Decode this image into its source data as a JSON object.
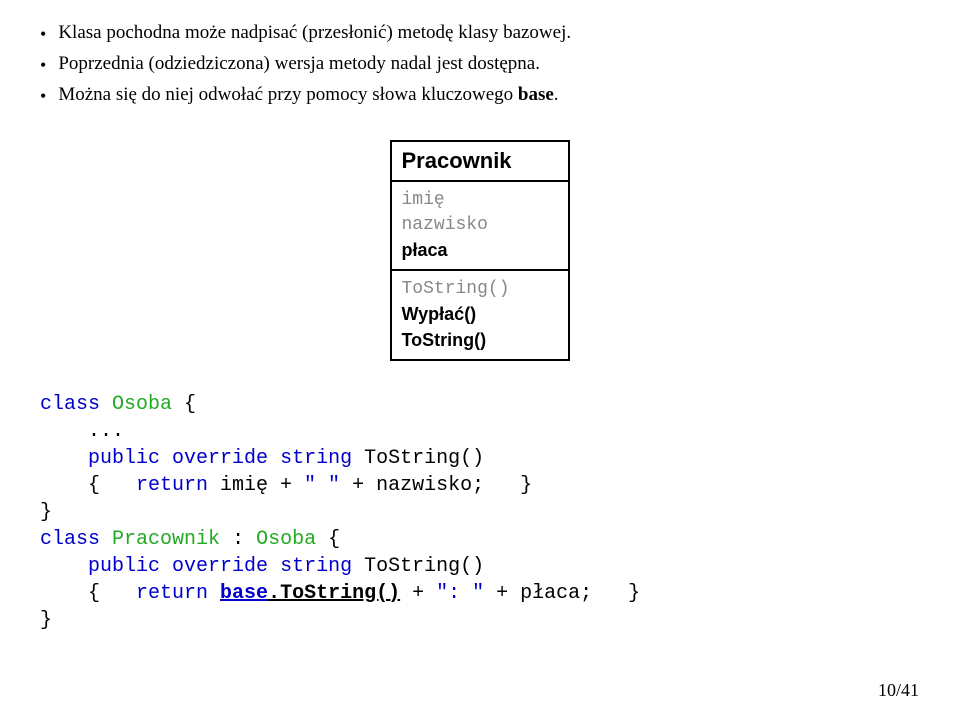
{
  "bullets": [
    {
      "text": "Klasa pochodna może nadpisać (przesłonić) metodę klasy bazowej."
    },
    {
      "text": "Poprzednia (odziedziczona) wersja metody nadal jest dostępna."
    },
    {
      "prefix": "Można się do niej odwołać przy pomocy słowa kluczowego ",
      "bold": "base",
      "suffix": "."
    }
  ],
  "uml": {
    "title": "Pracownik",
    "attrs": [
      {
        "text": "imię",
        "inherited": true
      },
      {
        "text": "nazwisko",
        "inherited": true
      },
      {
        "text": "płaca",
        "bold": true
      }
    ],
    "methods": [
      {
        "text": "ToString()",
        "inherited": true
      },
      {
        "text": "Wypłać()",
        "bold": true
      },
      {
        "text": "ToString()",
        "bold": true
      }
    ]
  },
  "code": {
    "line1_class": "class",
    "line1_type": "Osoba",
    "line1_brace": " {",
    "line2_dots": "    ...",
    "line3_public": "    public",
    "line3_override": "override",
    "line3_string": "string",
    "line3_method": " ToString()",
    "line4_brace_o": "    {   ",
    "line4_return": "return",
    "line4_text": " imię + ",
    "line4_str": "\" \"",
    "line4_text2": " + nazwisko;   }",
    "line5_brace": "}",
    "line6_class": "class",
    "line6_type": "Pracownik",
    "line6_colon": " : ",
    "line6_type2": "Osoba",
    "line6_brace": " {",
    "line7_public": "    public",
    "line7_override": "override",
    "line7_string": "string",
    "line7_method": " ToString()",
    "line8_brace_o": "    {   ",
    "line8_return": "return",
    "line8_space": " ",
    "line8_base": "base",
    "line8_dot": ".",
    "line8_tostring": "ToString()",
    "line8_text": " + ",
    "line8_str": "\": \"",
    "line8_text2": " + płaca;   }",
    "line9_brace": "}"
  },
  "page": "10/41"
}
